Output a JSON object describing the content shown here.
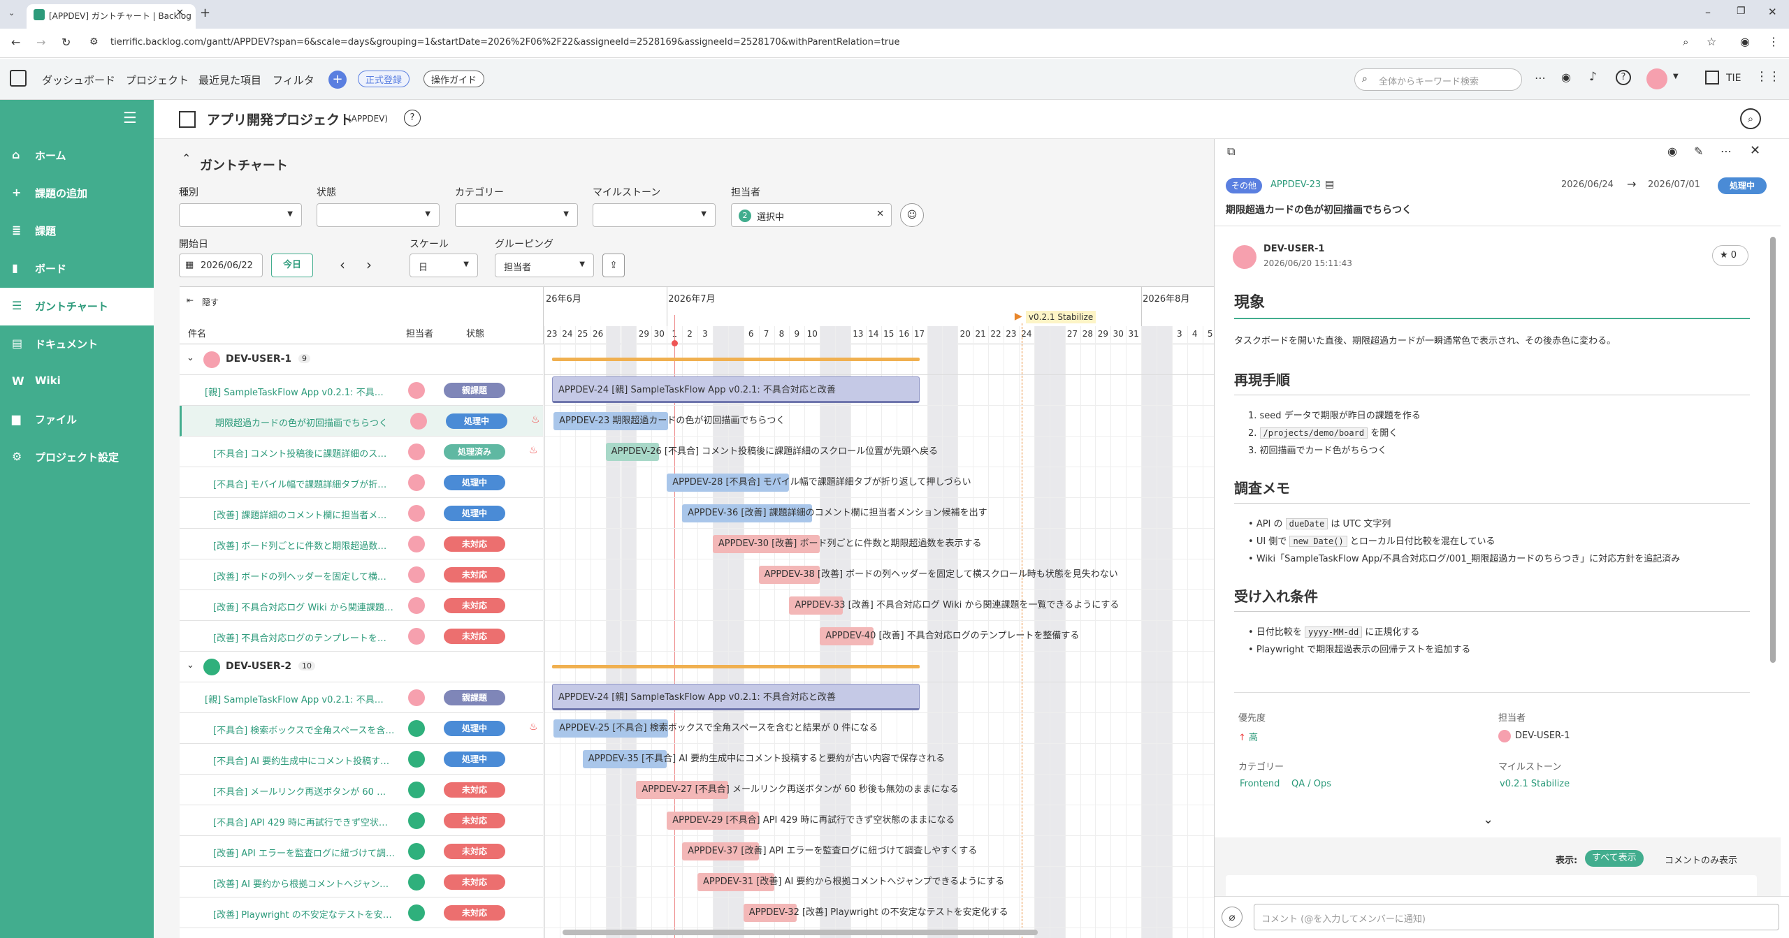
{
  "browser": {
    "tab_title": "[APPDEV] ガントチャート | Backlog",
    "url": "tierrific.backlog.com/gantt/APPDEV?span=6&scale=days&grouping=1&startDate=2026%2F06%2F22&assigneeId=2528169&assigneeId=2528170&withParentRelation=true"
  },
  "nav": {
    "dashboard": "ダッシュボード",
    "project": "プロジェクト",
    "recent": "最近見た項目",
    "filter": "フィルタ",
    "register": "正式登録",
    "guide": "操作ガイド",
    "search_placeholder": "全体からキーワード検索",
    "user_short": "TIE"
  },
  "sidebar": {
    "items": [
      {
        "icon": "home-icon",
        "label": "ホーム"
      },
      {
        "icon": "plus-icon",
        "label": "課題の追加"
      },
      {
        "icon": "list-icon",
        "label": "課題"
      },
      {
        "icon": "board-icon",
        "label": "ボード"
      },
      {
        "icon": "gantt-icon",
        "label": "ガントチャート"
      },
      {
        "icon": "document-icon",
        "label": "ドキュメント"
      },
      {
        "icon": "wiki-icon",
        "label": "Wiki"
      },
      {
        "icon": "file-icon",
        "label": "ファイル"
      },
      {
        "icon": "gear-icon",
        "label": "プロジェクト設定"
      }
    ]
  },
  "project": {
    "name": "アプリ開発プロジェクト",
    "key": "(APPDEV)"
  },
  "gantt": {
    "heading": "ガントチャート",
    "filters": {
      "type": "種別",
      "status": "状態",
      "category": "カテゴリー",
      "milestone": "マイルストーン",
      "assignee": "担当者",
      "assignee_count": "2",
      "assignee_value": "選択中",
      "start_label": "開始日",
      "start_value": "2026/06/22",
      "today": "今日",
      "scale_label": "スケール",
      "scale_value": "日",
      "grouping_label": "グルーピング",
      "grouping_value": "担当者"
    },
    "hide": "隠す",
    "col_title": "件名",
    "col_assignee": "担当者",
    "col_status": "状態",
    "months": [
      "26年6月",
      "2026年7月",
      "2026年8月"
    ],
    "days": [
      "23",
      "24",
      "25",
      "26",
      "27",
      "28",
      "29",
      "30",
      "1",
      "2",
      "3",
      "4",
      "5",
      "6",
      "7",
      "8",
      "9",
      "10",
      "11",
      "12",
      "13",
      "14",
      "15",
      "16",
      "17",
      "18",
      "19",
      "20",
      "21",
      "22",
      "23",
      "24",
      "25",
      "26",
      "27",
      "28",
      "29",
      "30",
      "31",
      "1",
      "2",
      "3",
      "4",
      "5"
    ],
    "milestone": "v0.2.1 Stabilize",
    "groups": [
      {
        "name": "DEV-USER-1",
        "count": "9",
        "rows": [
          {
            "title": "[親] SampleTaskFlow App v0.2.1: 不具合対応と改善",
            "status": "親課題",
            "color": "#7f86b8",
            "fire": false,
            "bar": "APPDEV-24 [親] SampleTaskFlow App v0.2.1: 不具合対応と改善"
          },
          {
            "title": "期限超過カードの色が初回描画でちらつく",
            "status": "処理中",
            "color": "#4a8bd6",
            "fire": true,
            "bar": "APPDEV-23 期限超過カードの色が初回描画でちらつく"
          },
          {
            "title": "[不具合] コメント投稿後に課題詳細のスクロール位置が先頭へ戻る",
            "status": "処理済み",
            "color": "#5fb8a2",
            "fire": true,
            "bar": "APPDEV-26 [不具合] コメント投稿後に課題詳細のスクロール位置が先頭へ戻る"
          },
          {
            "title": "[不具合] モバイル幅で課題詳細タブが折り返して押しづらい",
            "status": "処理中",
            "color": "#4a8bd6",
            "fire": false,
            "bar": "APPDEV-28 [不具合] モバイル幅で課題詳細タブが折り返して押しづらい"
          },
          {
            "title": "[改善] 課題詳細のコメント欄に担当者メンション候補を出す",
            "status": "処理中",
            "color": "#4a8bd6",
            "fire": false,
            "bar": "APPDEV-36 [改善] 課題詳細のコメント欄に担当者メンション候補を出す"
          },
          {
            "title": "[改善] ボード列ごとに件数と期限超過数を表示する",
            "status": "未対応",
            "color": "#ec6f6f",
            "fire": false,
            "bar": "APPDEV-30 [改善] ボード列ごとに件数と期限超過数を表示する"
          },
          {
            "title": "[改善] ボードの列ヘッダーを固定して横スクロール時も状態を見失わない",
            "status": "未対応",
            "color": "#ec6f6f",
            "fire": false,
            "bar": "APPDEV-38 [改善] ボードの列ヘッダーを固定して横スクロール時も状態を見失わない"
          },
          {
            "title": "[改善] 不具合対応ログ Wiki から関連課題を一覧できるようにする",
            "status": "未対応",
            "color": "#ec6f6f",
            "fire": false,
            "bar": "APPDEV-33 [改善] 不具合対応ログ Wiki から関連課題を一覧できるようにする"
          },
          {
            "title": "[改善] 不具合対応ログのテンプレートを整備する",
            "status": "未対応",
            "color": "#ec6f6f",
            "fire": false,
            "bar": "APPDEV-40 [改善] 不具合対応ログのテンプレートを整備する"
          }
        ]
      },
      {
        "name": "DEV-USER-2",
        "count": "10",
        "rows": [
          {
            "title": "[親] SampleTaskFlow App v0.2.1: 不具合対応と改善",
            "status": "親課題",
            "color": "#7f86b8",
            "fire": false,
            "bar": "APPDEV-24 [親] SampleTaskFlow App v0.2.1: 不具合対応と改善"
          },
          {
            "title": "[不具合] 検索ボックスで全角スペースを含むと結果が 0 件になる",
            "status": "処理中",
            "color": "#4a8bd6",
            "fire": true,
            "bar": "APPDEV-25 [不具合] 検索ボックスで全角スペースを含むと結果が 0 件になる"
          },
          {
            "title": "[不具合] AI 要約生成中にコメント投稿すると要約が古い内容で保存される",
            "status": "処理中",
            "color": "#4a8bd6",
            "fire": false,
            "bar": "APPDEV-35 [不具合] AI 要約生成中にコメント投稿すると要約が古い内容で保存される"
          },
          {
            "title": "[不具合] メールリンク再送ボタンが 60 秒後も無効のままになる",
            "status": "未対応",
            "color": "#ec6f6f",
            "fire": false,
            "bar": "APPDEV-27 [不具合] メールリンク再送ボタンが 60 秒後も無効のままになる"
          },
          {
            "title": "[不具合] API 429 時に再試行できず空状態のままになる",
            "status": "未対応",
            "color": "#ec6f6f",
            "fire": false,
            "bar": "APPDEV-29 [不具合] API 429 時に再試行できず空状態のままになる"
          },
          {
            "title": "[改善] API エラーを監査ログに紐づけて調査しやすくする",
            "status": "未対応",
            "color": "#ec6f6f",
            "fire": false,
            "bar": "APPDEV-37 [改善] API エラーを監査ログに紐づけて調査しやすくする"
          },
          {
            "title": "[改善] AI 要約から根拠コメントへジャンプできるようにする",
            "status": "未対応",
            "color": "#ec6f6f",
            "fire": false,
            "bar": "APPDEV-31 [改善] AI 要約から根拠コメントへジャンプできるようにする"
          },
          {
            "title": "[改善] Playwright の不安定なテストを安定化する",
            "status": "未対応",
            "color": "#ec6f6f",
            "fire": false,
            "bar": "APPDEV-32 [改善] Playwright の不安定なテストを安定化する"
          }
        ]
      }
    ]
  },
  "panel": {
    "category_badge": "その他",
    "issue_key": "APPDEV-23",
    "start": "2026/06/24",
    "end": "2026/07/01",
    "status": "処理中",
    "title": "期限超過カードの色が初回描画でちらつく",
    "author": "DEV-USER-1",
    "created": "2026/06/20 15:11:43",
    "stars": "0",
    "h_phenomenon": "現象",
    "phenomenon": "タスクボードを開いた直後、期限超過カードが一瞬通常色で表示され、その後赤色に変わる。",
    "h_repro": "再現手順",
    "repro": [
      "1. seed データで期限が昨日の課題を作る",
      "2.",
      "を開く",
      "3. 初回描画でカード色がちらつく"
    ],
    "repro_code": "/projects/demo/board",
    "h_investigation": "調査メモ",
    "inv1_a": "API の",
    "inv1_code": "dueDate",
    "inv1_b": "は UTC 文字列",
    "inv2_a": "UI 側で",
    "inv2_code": "new Date()",
    "inv2_b": "とローカル日付比較を混在している",
    "inv3": "Wiki「SampleTaskFlow App/不具合対応ログ/001_期限超過カードのちらつき」に対応方針を追記済み",
    "h_accept": "受け入れ条件",
    "acc1_a": "日付比較を",
    "acc1_code": "yyyy-MM-dd",
    "acc1_b": "に正規化する",
    "acc2": "Playwright で期限超過表示の回帰テストを追加する",
    "priority_label": "優先度",
    "priority": "高",
    "assignee_label": "担当者",
    "assignee": "DEV-USER-1",
    "category_label": "カテゴリー",
    "categories": [
      "Frontend",
      "QA / Ops"
    ],
    "milestone_label": "マイルストーン",
    "milestone": "v0.2.1 Stabilize",
    "display_label": "表示:",
    "show_all": "すべて表示",
    "comments_only": "コメントのみ表示",
    "comment_placeholder": "コメント (@を入力してメンバーに通知)"
  },
  "colors": {
    "brand": "#42ad8e",
    "parent_bar": "#c5c9e6",
    "inprogress_bar": "#a9c6ea",
    "done_bar": "#a8d8c8",
    "todo_bar": "#f3b7b7",
    "milestone_line": "#f0b050"
  }
}
